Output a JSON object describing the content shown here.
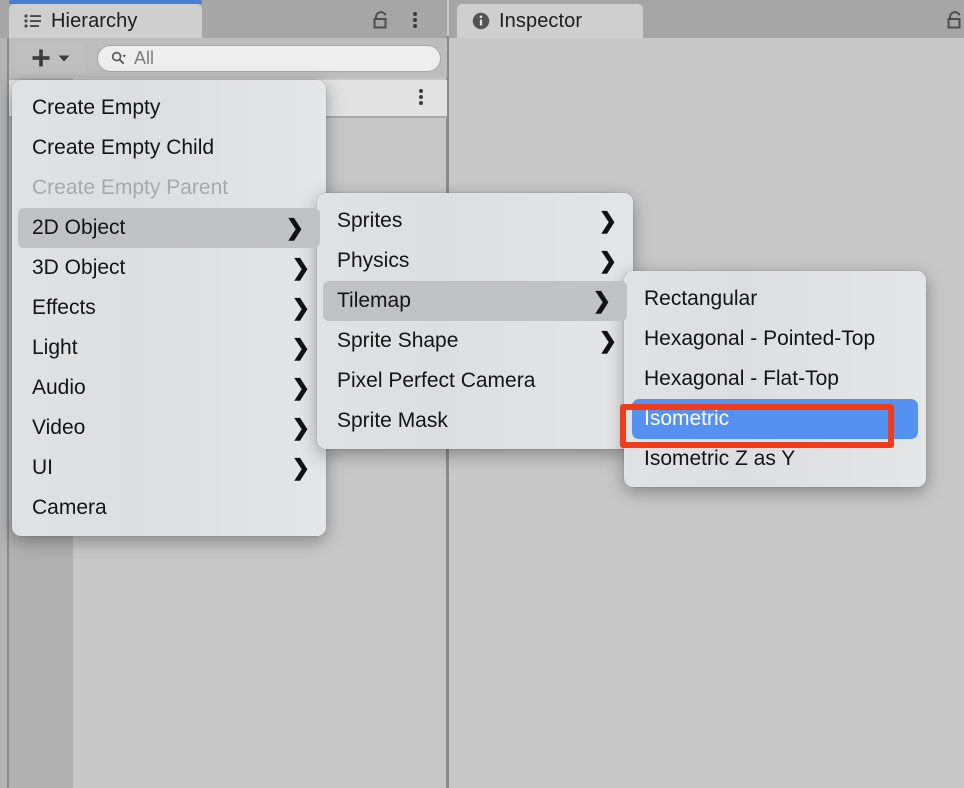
{
  "window": {
    "accent_blue": "#4a7fd0",
    "selection_blue": "#5591f0",
    "annotation_red": "#ef3d1b",
    "panel_bg": "#c8c8c8",
    "menu_bg": "#dcdfe1"
  },
  "tabs": {
    "hierarchy": {
      "label": "Hierarchy",
      "icon": "hierarchy-list-icon"
    },
    "inspector": {
      "label": "Inspector",
      "icon": "info-circle-icon"
    }
  },
  "toolbar": {
    "add_label": "+",
    "add_dropdown_caret": "▾",
    "search": {
      "value": "",
      "placeholder": "All",
      "icon": "search-magnifier-icon"
    }
  },
  "menus": {
    "create": {
      "name": "Create",
      "items": [
        {
          "label": "Create Empty",
          "submenu": false,
          "state": "normal"
        },
        {
          "label": "Create Empty Child",
          "submenu": false,
          "state": "normal"
        },
        {
          "label": "Create Empty Parent",
          "submenu": false,
          "state": "disabled"
        },
        {
          "label": "2D Object",
          "submenu": true,
          "state": "highlighted"
        },
        {
          "label": "3D Object",
          "submenu": true,
          "state": "normal"
        },
        {
          "label": "Effects",
          "submenu": true,
          "state": "normal"
        },
        {
          "label": "Light",
          "submenu": true,
          "state": "normal"
        },
        {
          "label": "Audio",
          "submenu": true,
          "state": "normal"
        },
        {
          "label": "Video",
          "submenu": true,
          "state": "normal"
        },
        {
          "label": "UI",
          "submenu": true,
          "state": "normal"
        },
        {
          "label": "Camera",
          "submenu": false,
          "state": "normal"
        }
      ]
    },
    "object2d": {
      "name": "2D Object",
      "items": [
        {
          "label": "Sprites",
          "submenu": true,
          "state": "normal"
        },
        {
          "label": "Physics",
          "submenu": true,
          "state": "normal"
        },
        {
          "label": "Tilemap",
          "submenu": true,
          "state": "highlighted"
        },
        {
          "label": "Sprite Shape",
          "submenu": true,
          "state": "normal"
        },
        {
          "label": "Pixel Perfect Camera",
          "submenu": false,
          "state": "normal"
        },
        {
          "label": "Sprite Mask",
          "submenu": false,
          "state": "normal"
        }
      ]
    },
    "tilemap": {
      "name": "Tilemap",
      "items": [
        {
          "label": "Rectangular",
          "submenu": false,
          "state": "normal"
        },
        {
          "label": "Hexagonal - Pointed-Top",
          "submenu": false,
          "state": "normal"
        },
        {
          "label": "Hexagonal - Flat-Top",
          "submenu": false,
          "state": "normal"
        },
        {
          "label": "Isometric",
          "submenu": false,
          "state": "selected"
        },
        {
          "label": "Isometric Z as Y",
          "submenu": false,
          "state": "normal"
        }
      ]
    }
  },
  "annotation": {
    "target": "Isometric",
    "shape": "rectangle",
    "color": "#ef3d1b"
  },
  "arrow_glyph": "❯"
}
